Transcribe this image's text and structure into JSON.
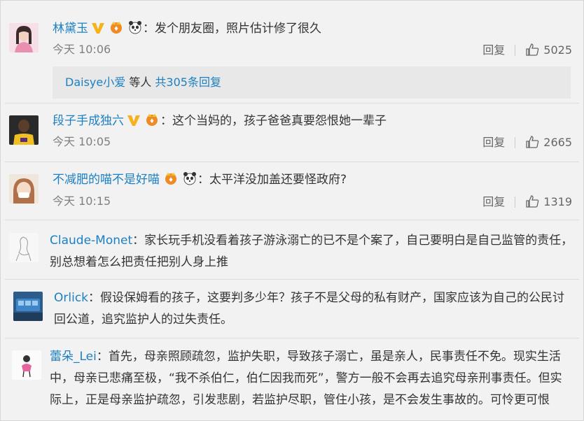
{
  "comments": [
    {
      "username": "林黛玉",
      "text": "：发个朋友圈，照片估计修了很久",
      "time": "今天 10:06",
      "reply_label": "回复",
      "likes": "5025",
      "sub_reply": {
        "user": "Daisye小爱",
        "middle": " 等人 ",
        "link": "共305条回复"
      }
    },
    {
      "username": "段子手成独六",
      "text": "：这个当妈的，孩子爸爸真要怨恨她一辈子",
      "time": "今天 10:05",
      "reply_label": "回复",
      "likes": "2665"
    },
    {
      "username": "不减肥的喵不是好喵",
      "text": "：太平洋没加盖还要怪政府?",
      "time": "今天 10:15",
      "reply_label": "回复",
      "likes": "1319"
    }
  ],
  "long_comments": [
    {
      "username": "Claude-Monet",
      "lines": [
        "：家长玩手机没看着孩子游泳溺亡的已不是个案了，自己要明白是自己监管的责任，",
        "别总想着怎么把责任把别人身上推"
      ]
    },
    {
      "username": "Orlick",
      "lines": [
        "：假设保姆看的孩子，这要判多少年？孩子不是父母的私有财产，国家应该为自己的公民讨",
        "回公道，追究监护人的过失责任。"
      ]
    },
    {
      "username": "蕾朵_Lei",
      "lines": [
        "：首先，母亲照顾疏忽，监护失职，导致孩子溺亡，虽是亲人，民事责任不免。现实生活",
        "中，母亲已悲痛至极，“我不杀伯仁，伯仁因我而死”，警方一般不会再去追究母亲刑事责任。但实",
        "际上，正是母亲监护疏忽，引发悲剧，若监护尽职，管住小孩，是不会发生事故的。可怜更可恨"
      ]
    }
  ],
  "colors": {
    "name_orange": "#eb7350",
    "link_blue": "#1d80c2",
    "time_gray": "#808080"
  }
}
